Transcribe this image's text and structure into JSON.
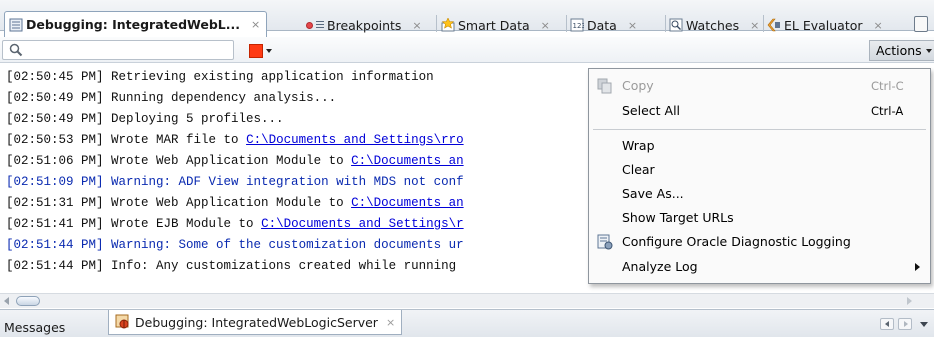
{
  "tabs": [
    {
      "label": "Debugging: IntegratedWebL...",
      "icon": "log-icon",
      "active": true,
      "close": "×"
    },
    {
      "label": "Breakpoints",
      "icon": "breakpoints-icon",
      "close": "×"
    },
    {
      "label": "Smart Data",
      "icon": "smart-data-icon",
      "close": "×"
    },
    {
      "label": "Data",
      "icon": "data-icon",
      "close": "×"
    },
    {
      "label": "Watches",
      "icon": "watches-icon",
      "close": "×"
    },
    {
      "label": "EL Evaluator",
      "icon": "el-evaluator-icon",
      "close": "×"
    }
  ],
  "toolbar": {
    "search_value": "",
    "actions_label": "Actions"
  },
  "log": [
    {
      "time": "[02:50:45 PM]",
      "text": " Retrieving existing application information",
      "link": "",
      "type": "info"
    },
    {
      "time": "[02:50:49 PM]",
      "text": " Running dependency analysis...",
      "link": "",
      "type": "info"
    },
    {
      "time": "[02:50:49 PM]",
      "text": " Deploying 5 profiles...",
      "link": "",
      "type": "info"
    },
    {
      "time": "[02:50:53 PM]",
      "text": " Wrote MAR file to ",
      "link": "C:\\Documents and Settings\\rro",
      "type": "info"
    },
    {
      "time": "[02:51:06 PM]",
      "text": " Wrote Web Application Module to ",
      "link": "C:\\Documents an",
      "type": "info"
    },
    {
      "time": "[02:51:09 PM]",
      "text": " Warning: ADF View integration with MDS not conf",
      "link": "",
      "type": "warn"
    },
    {
      "time": "[02:51:31 PM]",
      "text": " Wrote Web Application Module to ",
      "link": "C:\\Documents an",
      "type": "info"
    },
    {
      "time": "[02:51:41 PM]",
      "text": " Wrote EJB Module to ",
      "link": "C:\\Documents and Settings\\r",
      "type": "info"
    },
    {
      "time": "[02:51:44 PM]",
      "text": " Warning: Some of the customization documents ur",
      "link": "",
      "type": "warn"
    },
    {
      "time": "[02:51:44 PM]",
      "text": " Info: Any customizations created while running",
      "link": "",
      "type": "info"
    }
  ],
  "context_menu": [
    {
      "label": "Copy",
      "shortcut": "Ctrl-C",
      "disabled": true,
      "icon": "copy-icon"
    },
    {
      "label": "Select All",
      "shortcut": "Ctrl-A",
      "disabled": false
    },
    {
      "label": "Wrap",
      "shortcut": "",
      "disabled": false
    },
    {
      "label": "Clear",
      "shortcut": "",
      "disabled": false
    },
    {
      "label": "Save As...",
      "shortcut": "",
      "disabled": false
    },
    {
      "label": "Show Target URLs",
      "shortcut": "",
      "disabled": false
    },
    {
      "label": "Configure Oracle Diagnostic Logging",
      "shortcut": "",
      "disabled": false,
      "icon": "configure-logging-icon"
    },
    {
      "label": "Analyze Log",
      "shortcut": "",
      "disabled": false,
      "submenu": true
    }
  ],
  "bottom_tabs": [
    {
      "label": "Messages",
      "active": false
    },
    {
      "label": "Debugging: IntegratedWebLogicServer",
      "active": true,
      "close": "×"
    }
  ],
  "colors": {
    "accent_blue": "#0a2ab0",
    "link": "#0000d8",
    "stop": "#ff3b14"
  }
}
